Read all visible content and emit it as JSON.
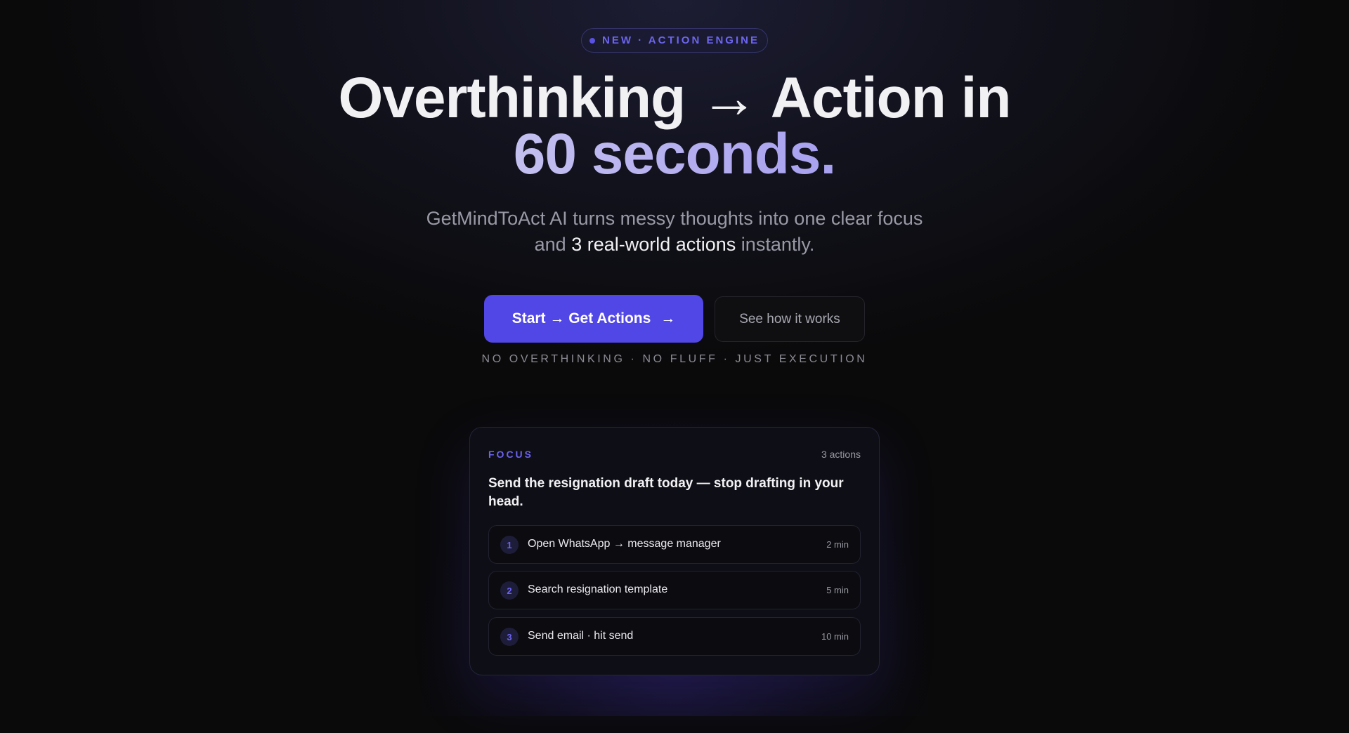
{
  "badge": {
    "text": "NEW · ACTION ENGINE"
  },
  "hero": {
    "headline_line1": "Overthinking → Action in",
    "headline_line2": "60 seconds.",
    "subtitle_part1": "GetMindToAct AI turns messy thoughts into one clear focus",
    "subtitle_part2": "and ",
    "subtitle_highlight": "3 real-world actions",
    "subtitle_part3": " instantly."
  },
  "buttons": {
    "primary_label": "Start → Get Actions",
    "primary_arrow": "→",
    "secondary_label": "See how it works"
  },
  "tagline": "NO OVERTHINKING · NO FLUFF · JUST EXECUTION",
  "card": {
    "label": "FOCUS",
    "count": "3 actions",
    "focus_text": "Send the resignation draft today — stop drafting in your head.",
    "actions": [
      {
        "num": "1",
        "text": "Open WhatsApp → message manager",
        "time": "2 min"
      },
      {
        "num": "2",
        "text": "Search resignation template",
        "time": "5 min"
      },
      {
        "num": "3",
        "text": "Send email · hit send",
        "time": "10 min"
      }
    ]
  },
  "colors": {
    "accent": "#5146e6",
    "accent_text": "#6c63ee",
    "background": "#0a0a0b"
  }
}
